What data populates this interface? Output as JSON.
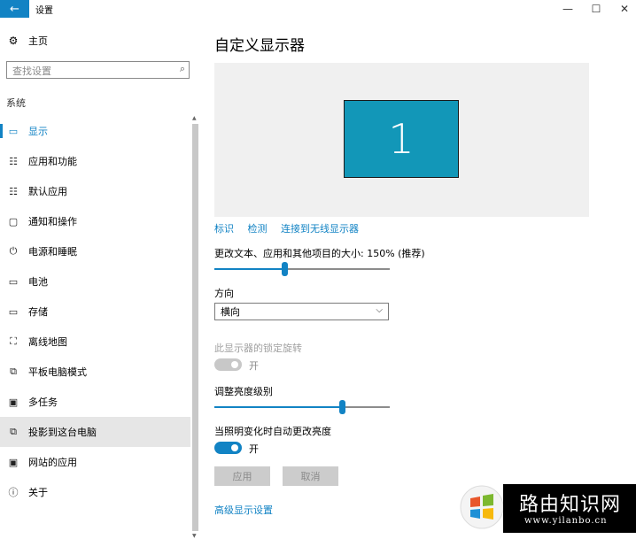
{
  "window": {
    "title": "设置",
    "back_icon": "←",
    "minimize_icon": "—",
    "maximize_icon": "☐",
    "close_icon": "✕"
  },
  "sidebar": {
    "home_icon": "⚙",
    "home_label": "主页",
    "search_placeholder": "查找设置",
    "search_icon": "⌕",
    "section_label": "系统",
    "items": [
      {
        "icon": "▭",
        "label": "显示"
      },
      {
        "icon": "☷",
        "label": "应用和功能"
      },
      {
        "icon": "☷",
        "label": "默认应用"
      },
      {
        "icon": "▢",
        "label": "通知和操作"
      },
      {
        "icon": "⏻",
        "label": "电源和睡眠"
      },
      {
        "icon": "▭",
        "label": "电池"
      },
      {
        "icon": "▭",
        "label": "存储"
      },
      {
        "icon": "⛶",
        "label": "离线地图"
      },
      {
        "icon": "⧉",
        "label": "平板电脑模式"
      },
      {
        "icon": "▣",
        "label": "多任务"
      },
      {
        "icon": "⧉",
        "label": "投影到这台电脑"
      },
      {
        "icon": "▣",
        "label": "网站的应用"
      },
      {
        "icon": "ⓘ",
        "label": "关于"
      }
    ],
    "active_index": 0,
    "hover_index": 10
  },
  "main": {
    "title": "自定义显示器",
    "monitor_number": "1",
    "links": [
      "标识",
      "检测",
      "连接到无线显示器"
    ],
    "text_size_label": "更改文本、应用和其他项目的大小: 150% (推荐)",
    "text_size_slider_value": 0.4,
    "orientation_label": "方向",
    "orientation_value": "横向",
    "rotation_lock_label": "此显示器的锁定旋转",
    "rotation_lock_state": "开",
    "brightness_label": "调整亮度级别",
    "brightness_slider_value": 0.74,
    "auto_brightness_label": "当照明变化时自动更改亮度",
    "auto_brightness_state": "开",
    "apply_label": "应用",
    "cancel_label": "取消",
    "advanced_link": "高级显示设置"
  },
  "watermark": {
    "title": "路由知识网",
    "url": "www.yilanbo.cn"
  },
  "colors": {
    "accent": "#1283c4",
    "monitor": "#1297b8",
    "panel": "#f0f0f0"
  }
}
